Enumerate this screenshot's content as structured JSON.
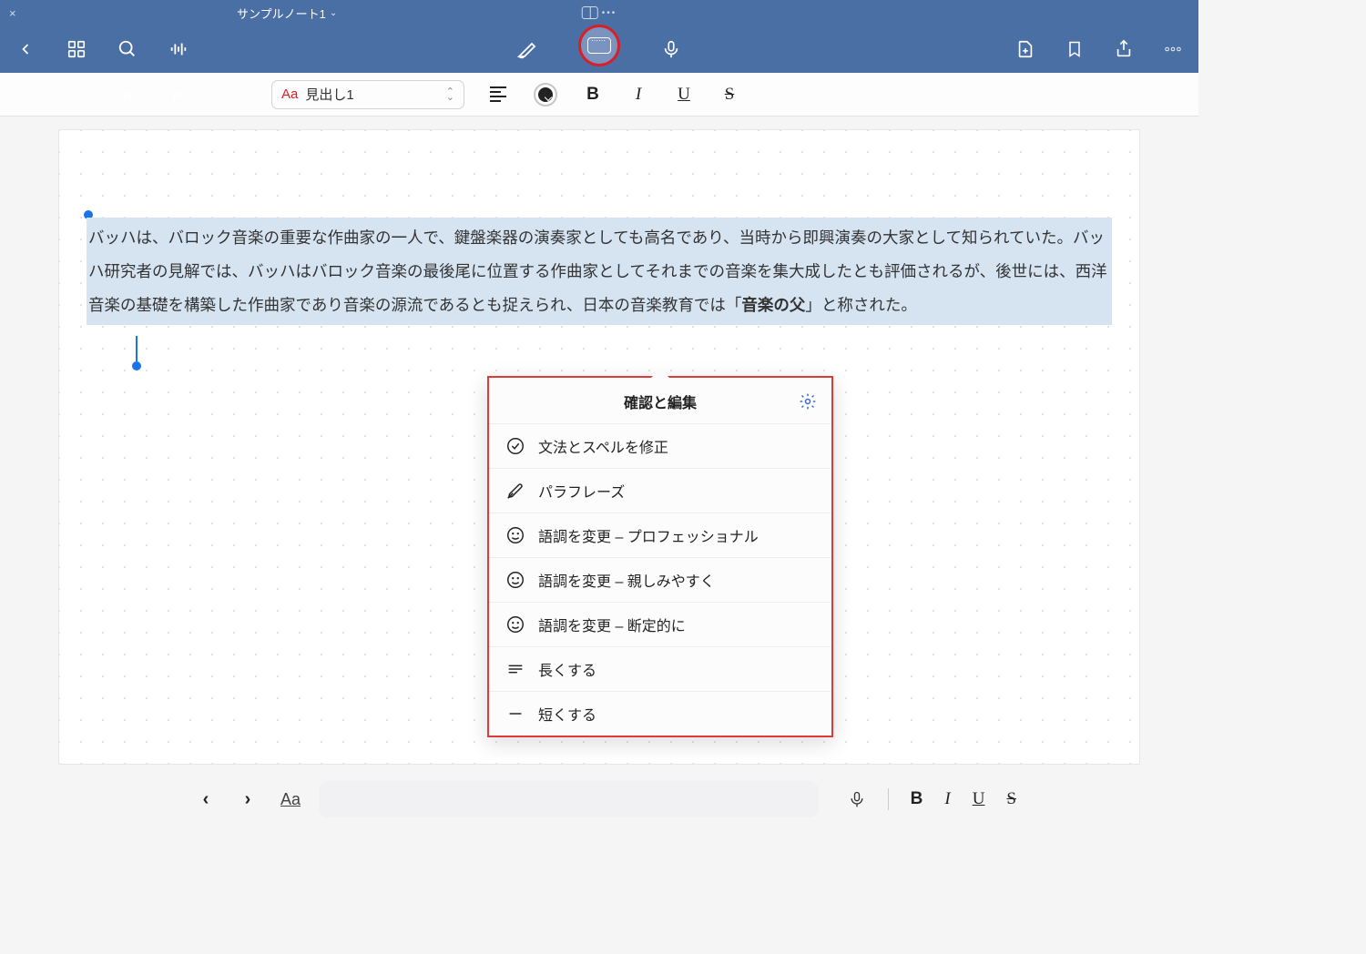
{
  "titlebar": {
    "document_name": "サンプルノート1"
  },
  "formatbar": {
    "style_label": "見出し1"
  },
  "document": {
    "text_before_bold": "バッハは、バロック音楽の重要な作曲家の一人で、鍵盤楽器の演奏家としても高名であり、当時から即興演奏の大家として知られていた。バッハ研究者の見解では、バッハはバロック音楽の最後尾に位置する作曲家としてそれまでの音楽を集大成したとも評価されるが、後世には、西洋音楽の基礎を構築した作曲家であり音楽の源流であるとも捉えられ、日本の音楽教育では「",
    "text_bold": "音楽の父",
    "text_after_bold": "」と称された。"
  },
  "context_menu": {
    "title": "確認と編集",
    "items": [
      {
        "label": "文法とスペルを修正",
        "icon": "check"
      },
      {
        "label": "パラフレーズ",
        "icon": "pen"
      },
      {
        "label": "語調を変更 – プロフェッショナル",
        "icon": "smile"
      },
      {
        "label": "語調を変更 – 親しみやすく",
        "icon": "smile"
      },
      {
        "label": "語調を変更 – 断定的に",
        "icon": "smile"
      },
      {
        "label": "長くする",
        "icon": "lines"
      },
      {
        "label": "短くする",
        "icon": "minus"
      }
    ]
  },
  "colors": {
    "brand_blue": "#4a6fa5",
    "highlight_red": "#d72027",
    "selection_blue": "#d6e4f2"
  }
}
